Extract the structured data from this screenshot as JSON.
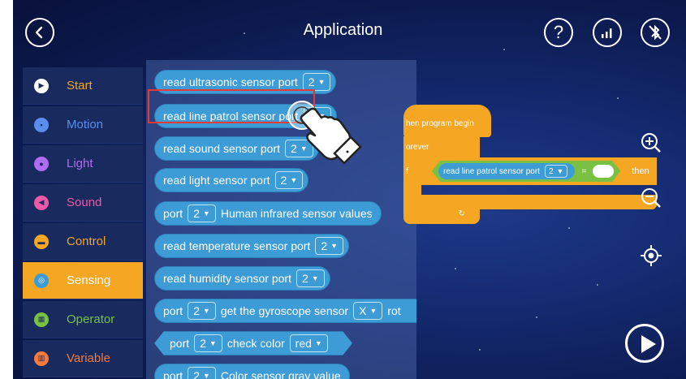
{
  "header": {
    "title": "Application",
    "help_label": "?"
  },
  "sidebar": {
    "items": [
      {
        "label": "Start",
        "color": "#f5a623",
        "icon": "play-icon"
      },
      {
        "label": "Motion",
        "color": "#5b8def",
        "icon": "car-icon"
      },
      {
        "label": "Light",
        "color": "#b06cf0",
        "icon": "bulb-icon"
      },
      {
        "label": "Sound",
        "color": "#ec5aa6",
        "icon": "speaker-icon"
      },
      {
        "label": "Control",
        "color": "#f5a623",
        "icon": "gamepad-icon"
      },
      {
        "label": "Sensing",
        "color": "#ffffff",
        "icon": "sensor-icon",
        "active": true
      },
      {
        "label": "Operator",
        "color": "#7ac143",
        "icon": "calculator-icon"
      },
      {
        "label": "Variable",
        "color": "#f57a3d",
        "icon": "variable-icon"
      }
    ]
  },
  "palette": {
    "blocks": [
      {
        "pre": "read ultrasonic sensor  port",
        "port": "2"
      },
      {
        "pre": "read line patrol sensor  port",
        "port": "2"
      },
      {
        "pre": "read sound  sensor  port",
        "port": "2"
      },
      {
        "pre": "read light  sensor  port",
        "port": "2"
      },
      {
        "pre": "port",
        "port": "2",
        "post": "Human infrared sensor values"
      },
      {
        "pre": "read temperature  sensor  port",
        "port": "2"
      },
      {
        "pre": "read humidity  sensor  port",
        "port": "2"
      },
      {
        "pre": "port",
        "port": "2",
        "post": "get the gyroscope sensor",
        "axis": "X",
        "tail": "rot"
      },
      {
        "pre": "port",
        "port": "2",
        "post": "check color",
        "color_opt": "red"
      },
      {
        "pre": "port",
        "port": "2",
        "post": "Color sensor gray value"
      }
    ]
  },
  "program": {
    "hat_label": "hen program begin",
    "forever_label": "orever",
    "if_label": "f",
    "cond_text": "read line patrol sensor port",
    "cond_port": "2",
    "eq": "=",
    "then_label": "then"
  },
  "colors": {
    "accent": "#f5a623",
    "sensing_block": "#3d9bd6",
    "highlight": "#e53935"
  }
}
